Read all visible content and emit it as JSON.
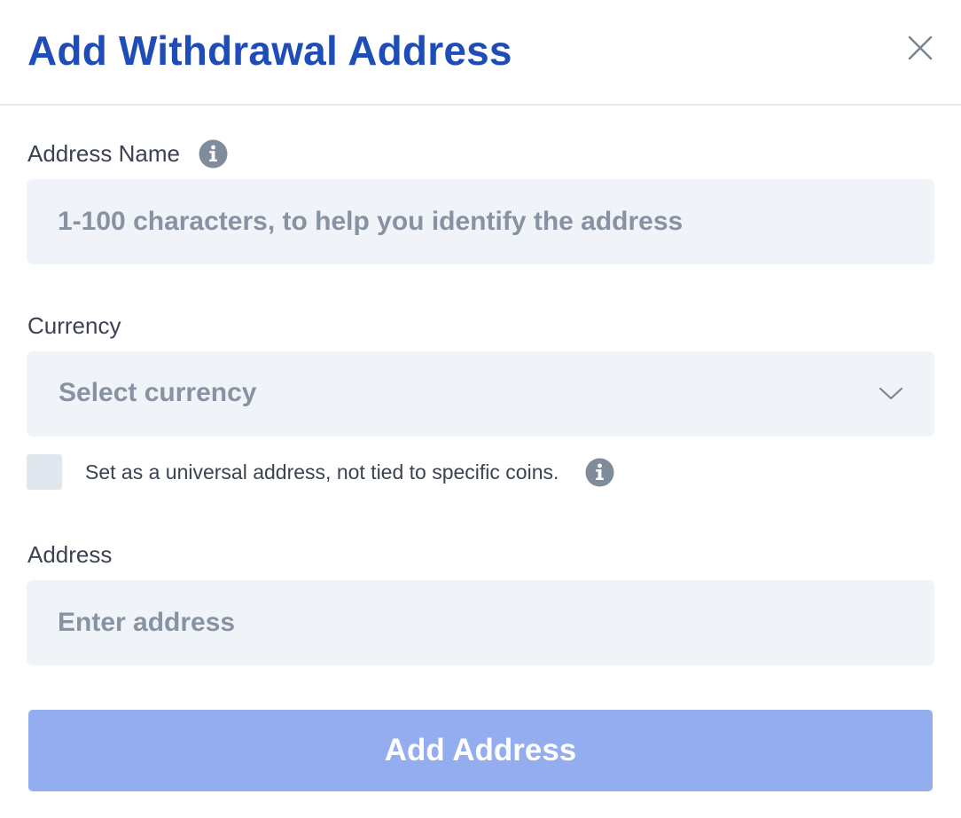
{
  "dialog": {
    "title": "Add Withdrawal Address",
    "close_icon": "close-icon"
  },
  "address_name": {
    "label": "Address Name",
    "info_icon": "info-icon",
    "placeholder": "1-100 characters, to help you identify the address",
    "value": ""
  },
  "currency": {
    "label": "Currency",
    "selected": "Select currency",
    "dropdown_icon": "chevron-down-icon"
  },
  "universal": {
    "checked": false,
    "label": "Set as a universal address, not tied to specific coins.",
    "info_icon": "info-icon"
  },
  "address": {
    "label": "Address",
    "placeholder": "Enter address",
    "value": ""
  },
  "submit": {
    "label": "Add Address"
  },
  "colors": {
    "title": "#1e4db7",
    "button_disabled": "#93adee",
    "field_bg": "#f0f3f8",
    "icon_gray": "#8792a2"
  }
}
